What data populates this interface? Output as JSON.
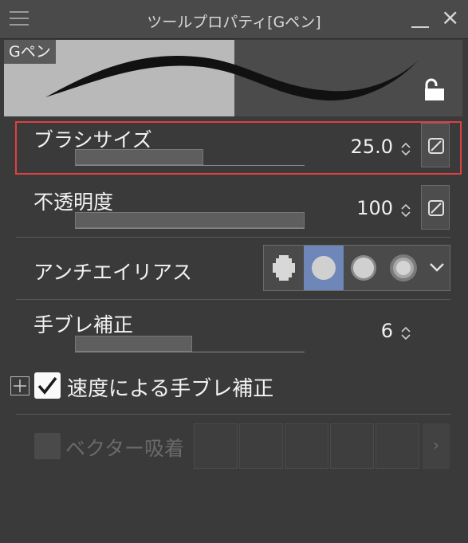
{
  "panel": {
    "title": "ツールプロパティ[Gペン]",
    "pen_label": "Gペン"
  },
  "brush_size": {
    "label": "ブラシサイズ",
    "value": "25.0",
    "level": 0.56
  },
  "opacity": {
    "label": "不透明度",
    "value": "100",
    "level": 1.0
  },
  "antialiasing": {
    "label": "アンチエイリアス",
    "options": [
      "none",
      "weak",
      "medium",
      "strong"
    ],
    "selected": "weak"
  },
  "stabilization": {
    "label": "手ブレ補正",
    "value": "6",
    "level": 0.51
  },
  "speed_stabilization": {
    "label": "速度による手ブレ補正",
    "checked": true
  },
  "vector_snap": {
    "label": "ベクター吸着",
    "checked": false,
    "enabled": false,
    "options_count": 5
  },
  "colors": {
    "panel_bg": "#3a3a3a",
    "selected_accent": "#6f86b8",
    "highlight_border": "#e04040"
  },
  "icons": [
    "menu-icon",
    "minimize-icon",
    "close-icon",
    "lock-open-icon",
    "pressure-toggle-icon",
    "spinner-icon",
    "chevron-down-icon",
    "chevron-right-icon",
    "expand-plus-icon",
    "checkmark-icon"
  ]
}
